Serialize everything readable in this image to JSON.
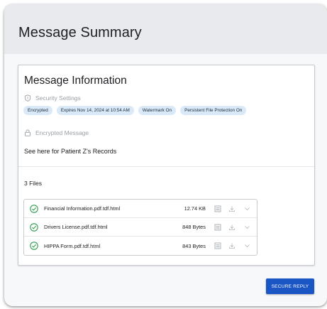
{
  "header": {
    "title": "Message Summary"
  },
  "message_info": {
    "title": "Message Information",
    "security_label": "Security Settings",
    "security_icon": "shield-icon",
    "chips": [
      "Encrypted",
      "Expires Nov 14, 2024 at 10:54 AM",
      "Watermark On",
      "Persistent File Protection On"
    ],
    "encrypted_label": "Encrypted Message",
    "encrypted_icon": "lock-icon",
    "body": "See here for Patient Z's Records"
  },
  "files": {
    "count_label": "3 Files",
    "items": [
      {
        "name": "Financial Information.pdf.tdf.html",
        "size": "12.74 KB"
      },
      {
        "name": "Drivers License.pdf.tdf.html",
        "size": "848 Bytes"
      },
      {
        "name": "HIPPA Form.pdf.tdf.html",
        "size": "843 Bytes"
      }
    ]
  },
  "actions": {
    "secure_reply": "SECURE REPLY"
  },
  "colors": {
    "accent": "#1a56c4",
    "chip_bg": "#d9e9f7",
    "success": "#2e9e4f",
    "header_bg": "#e8eaed"
  }
}
